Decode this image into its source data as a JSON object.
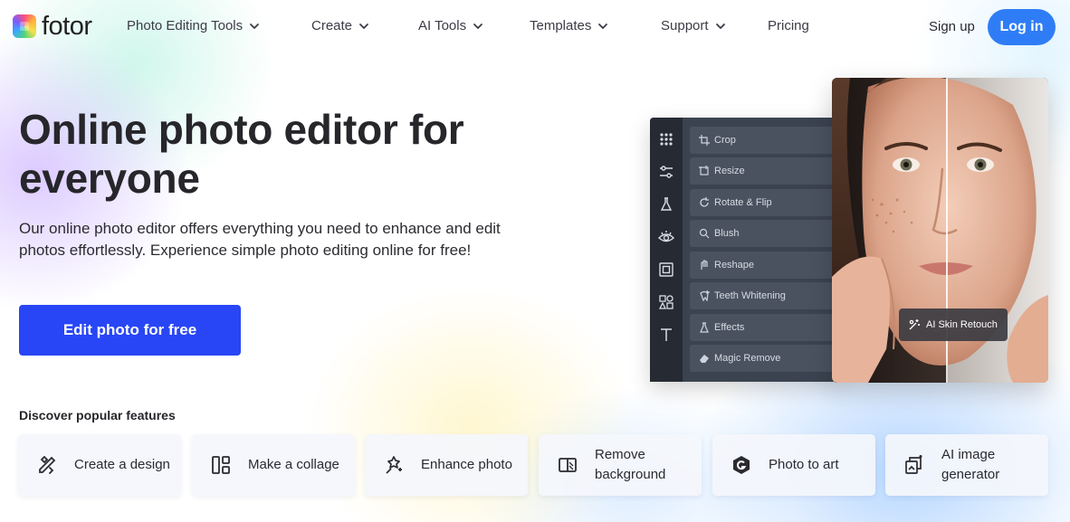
{
  "brand": {
    "name": "fotor"
  },
  "nav": {
    "items": [
      {
        "label": "Photo Editing Tools",
        "has_dropdown": true
      },
      {
        "label": "Create",
        "has_dropdown": true
      },
      {
        "label": "AI Tools",
        "has_dropdown": true
      },
      {
        "label": "Templates",
        "has_dropdown": true
      },
      {
        "label": "Support",
        "has_dropdown": true
      },
      {
        "label": "Pricing",
        "has_dropdown": false
      }
    ],
    "signup_label": "Sign up",
    "login_label": "Log in"
  },
  "hero": {
    "title": "Online photo editor for everyone",
    "description": "Our online photo editor offers everything you need to enhance and edit photos effortlessly. Experience simple photo editing online for free!",
    "cta_label": "Edit photo for free"
  },
  "editor_mockup": {
    "menu_items": [
      {
        "label": "Crop",
        "icon": "crop-icon"
      },
      {
        "label": "Resize",
        "icon": "resize-icon"
      },
      {
        "label": "Rotate & Flip",
        "icon": "rotate-icon"
      },
      {
        "label": "Blush",
        "icon": "blush-icon"
      },
      {
        "label": "Reshape",
        "icon": "reshape-icon"
      },
      {
        "label": "Teeth Whitening",
        "icon": "teeth-icon"
      },
      {
        "label": "Effects",
        "icon": "effects-icon"
      },
      {
        "label": "Magic Remove",
        "icon": "eraser-icon"
      }
    ],
    "rail_icons": [
      "grid-icon",
      "sliders-icon",
      "flask-icon",
      "eye-icon",
      "frame-icon",
      "shapes-icon",
      "text-icon"
    ],
    "badge_label": "AI Skin Retouch"
  },
  "features": {
    "title": "Discover popular features",
    "items": [
      {
        "label": "Create a design",
        "icon": "design-icon"
      },
      {
        "label": "Make a collage",
        "icon": "collage-icon"
      },
      {
        "label": "Enhance photo",
        "icon": "enhance-icon"
      },
      {
        "label": "Remove background",
        "icon": "remove-bg-icon"
      },
      {
        "label": "Photo to art",
        "icon": "art-icon"
      },
      {
        "label": "AI image generator",
        "icon": "ai-generator-icon"
      }
    ]
  },
  "colors": {
    "primary": "#2846f5",
    "login": "#2f7df6",
    "editor_panel": "#3b4350"
  }
}
